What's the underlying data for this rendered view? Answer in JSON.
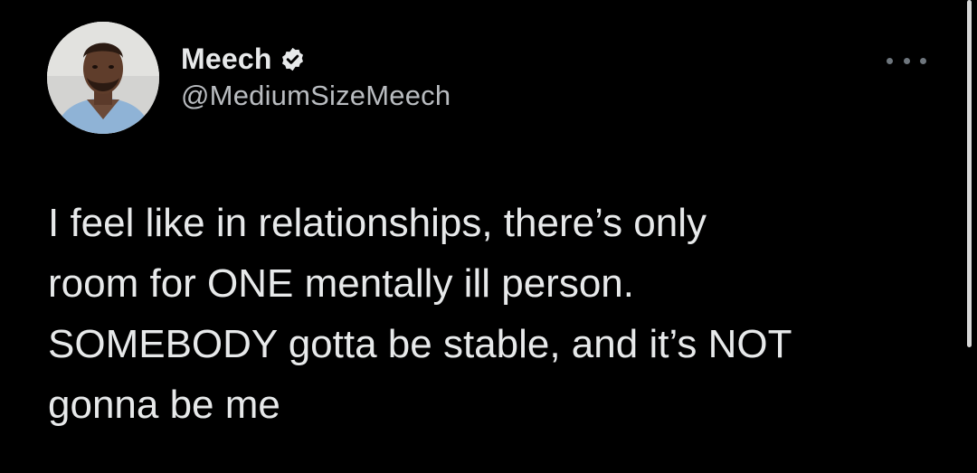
{
  "tweet": {
    "author": {
      "display_name": "Meech",
      "handle": "@MediumSizeMeech",
      "verified": true,
      "avatar_icon": "profile-photo"
    },
    "menu_icon": "more-horizontal-icon",
    "text_lines": [
      "I feel like in relationships, there’s only",
      "room for ONE mentally ill person.",
      "SOMEBODY gotta be stable, and it’s NOT",
      "gonna be me"
    ]
  },
  "theme": {
    "background": "#000000",
    "text": "#e7e9ea",
    "secondary_text": "#b9bcc0",
    "verified_badge": "#e7e9ea"
  }
}
